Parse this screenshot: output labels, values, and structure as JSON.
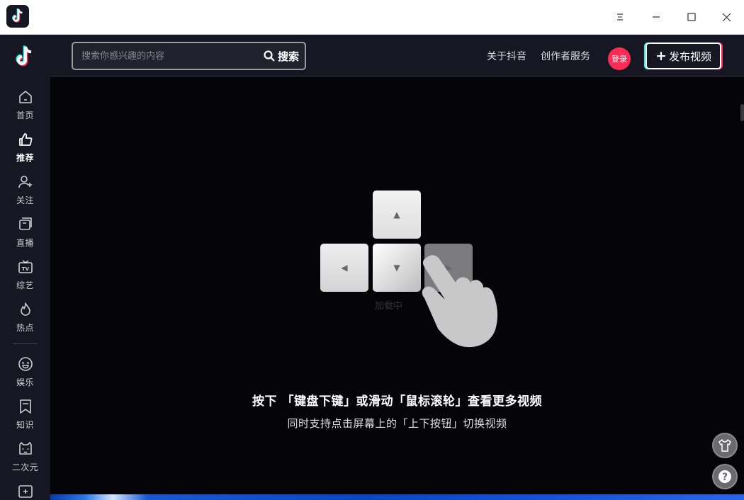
{
  "window": {
    "title_icon": "tiktok-logo-icon"
  },
  "sidebar": {
    "items": [
      {
        "label": "首页",
        "icon": "home-icon",
        "active": false
      },
      {
        "label": "推荐",
        "icon": "thumbs-up-icon",
        "active": true
      },
      {
        "label": "关注",
        "icon": "user-add-icon",
        "active": false
      },
      {
        "label": "直播",
        "icon": "live-icon",
        "active": false
      },
      {
        "label": "综艺",
        "icon": "tv-icon",
        "active": false
      },
      {
        "label": "热点",
        "icon": "flame-icon",
        "active": false
      },
      {
        "label": "娱乐",
        "icon": "laugh-icon",
        "active": false
      },
      {
        "label": "知识",
        "icon": "bookmark-icon",
        "active": false
      },
      {
        "label": "二次元",
        "icon": "anime-icon",
        "active": false
      }
    ]
  },
  "header": {
    "search": {
      "placeholder": "搜索你感兴趣的内容",
      "button_label": "搜索"
    },
    "links": {
      "about": "关于抖音",
      "creator": "创作者服务"
    },
    "login_label": "登录",
    "publish_label": "发布视频"
  },
  "main": {
    "loading_text": "加载中",
    "hint_main": "按下 「键盘下键」或滑动「鼠标滚轮」查看更多视频",
    "hint_sub": "同时支持点击屏幕上的「上下按钮」切换视频"
  },
  "colors": {
    "accent_red": "#fe2c55",
    "accent_cyan": "#25f4ee",
    "background": "#161722"
  }
}
